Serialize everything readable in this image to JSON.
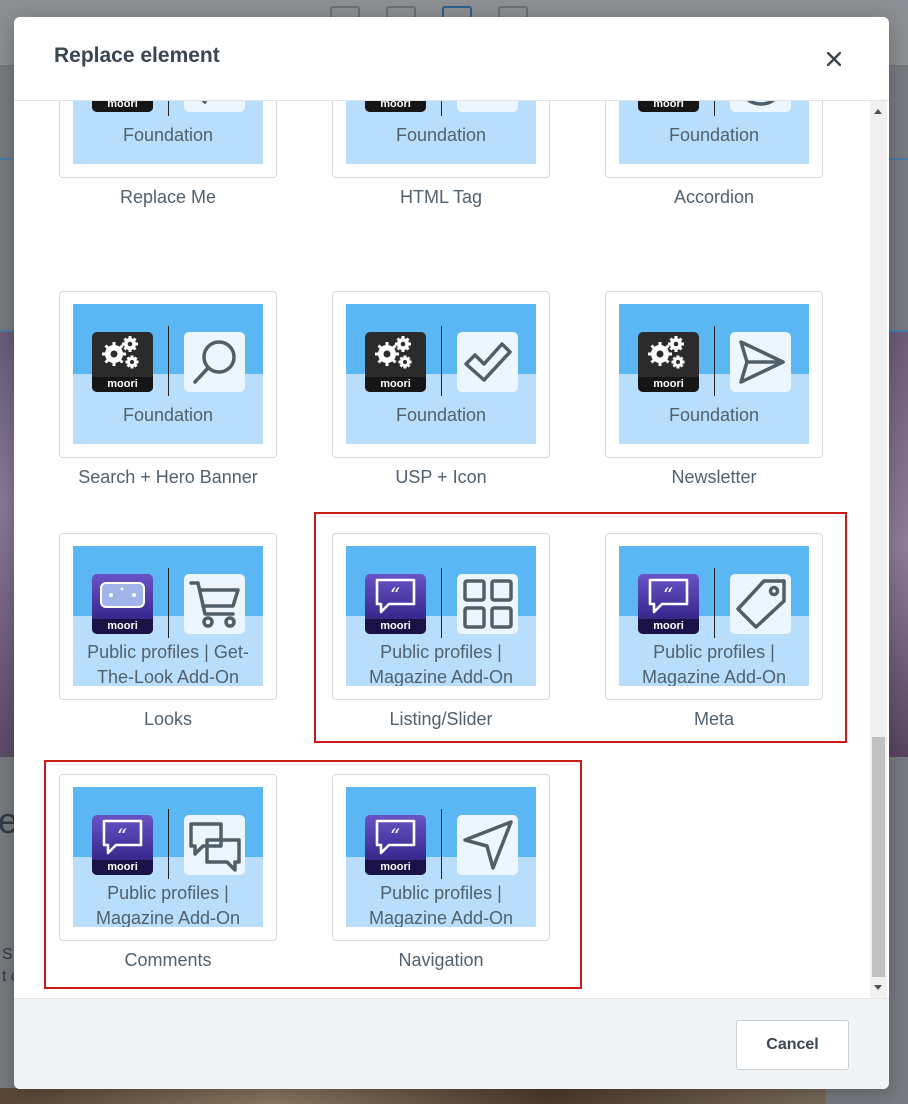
{
  "modal": {
    "title": "Replace element",
    "close_glyph": "×",
    "cancel_label": "Cancel"
  },
  "background": {
    "letter": "e",
    "small_line1": "S",
    "small_line2": "t c"
  },
  "colors": {
    "accent_blue": "#5ab7f4",
    "light_blue": "#b8defb",
    "highlight_red": "#cc1a1a",
    "text": "#51616e"
  },
  "elements": [
    {
      "name": "Replace Me",
      "plugin": "Foundation",
      "logo": "gears",
      "icon": "repeat-icon"
    },
    {
      "name": "HTML Tag",
      "plugin": "Foundation",
      "logo": "gears",
      "icon": "code-icon"
    },
    {
      "name": "Accordion",
      "plugin": "Foundation",
      "logo": "gears",
      "icon": "menu-circle-icon"
    },
    {
      "name": "Search + Hero Banner",
      "plugin": "Foundation",
      "logo": "gears",
      "icon": "search-icon"
    },
    {
      "name": "USP + Icon",
      "plugin": "Foundation",
      "logo": "gears",
      "icon": "check-icon"
    },
    {
      "name": "Newsletter",
      "plugin": "Foundation",
      "logo": "gears",
      "icon": "send-icon"
    },
    {
      "name": "Looks",
      "plugin_line1": "Public profiles | Get-",
      "plugin_line2": "The-Look Add-On",
      "logo": "looks",
      "icon": "cart-icon"
    },
    {
      "name": "Listing/Slider",
      "plugin_line1": "Public profiles |",
      "plugin_line2": "Magazine Add-On",
      "logo": "quote",
      "icon": "grid-icon"
    },
    {
      "name": "Meta",
      "plugin_line1": "Public profiles |",
      "plugin_line2": "Magazine Add-On",
      "logo": "quote",
      "icon": "tag-icon"
    },
    {
      "name": "Comments",
      "plugin_line1": "Public profiles |",
      "plugin_line2": "Magazine Add-On",
      "logo": "quote",
      "icon": "chat-icon"
    },
    {
      "name": "Navigation",
      "plugin_line1": "Public profiles |",
      "plugin_line2": "Magazine Add-On",
      "logo": "quote",
      "icon": "navigation-icon"
    }
  ],
  "logo_word": "moori"
}
